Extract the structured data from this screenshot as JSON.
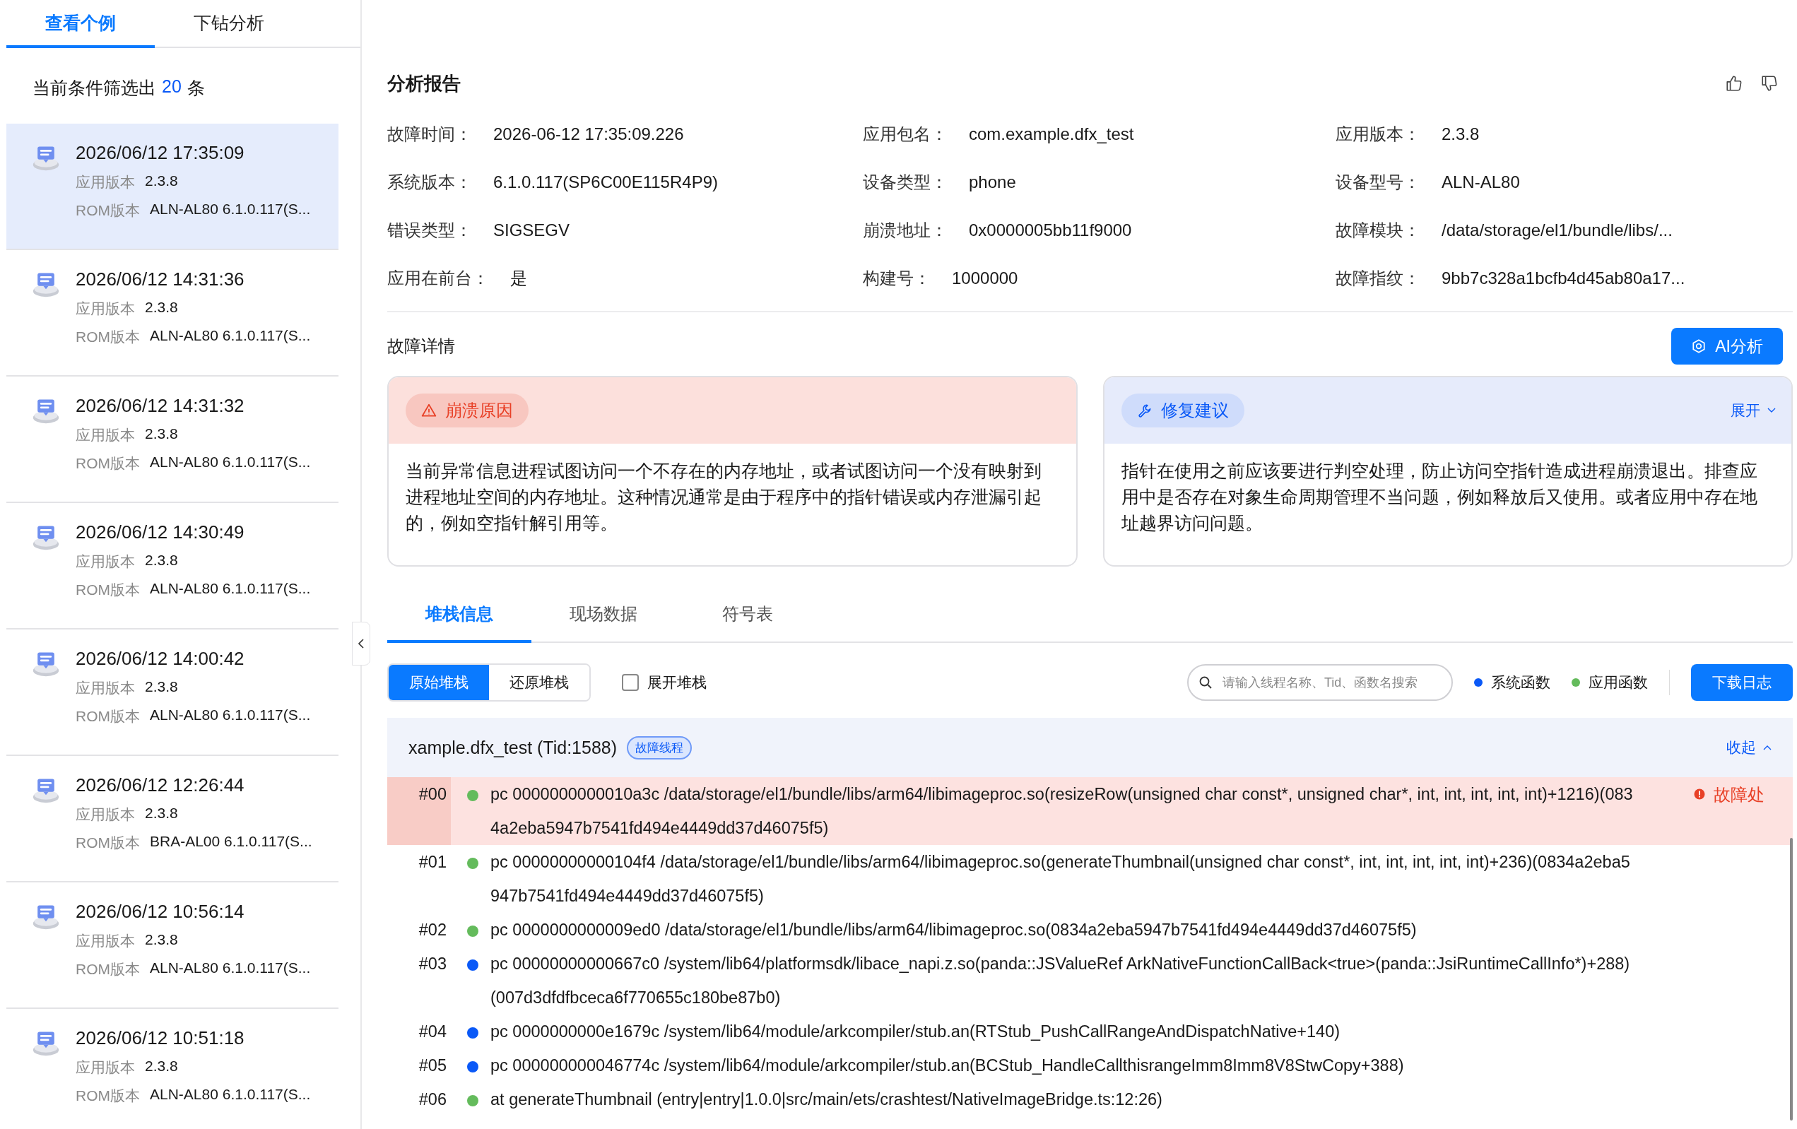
{
  "tabs": [
    {
      "label": "查看个例",
      "selected": true
    },
    {
      "label": "下钻分析",
      "selected": false
    }
  ],
  "filter": {
    "prefix": "当前条件筛选出",
    "count": "20",
    "suffix": "条"
  },
  "cases": [
    {
      "time": "2026/06/12 17:35:09",
      "app_label": "应用版本",
      "app_version": "2.3.8",
      "rom_label": "ROM版本",
      "rom": "ALN-AL80 6.1.0.117(S...",
      "selected": true
    },
    {
      "time": "2026/06/12 14:31:36",
      "app_label": "应用版本",
      "app_version": "2.3.8",
      "rom_label": "ROM版本",
      "rom": "ALN-AL80 6.1.0.117(S...",
      "selected": false
    },
    {
      "time": "2026/06/12 14:31:32",
      "app_label": "应用版本",
      "app_version": "2.3.8",
      "rom_label": "ROM版本",
      "rom": "ALN-AL80 6.1.0.117(S...",
      "selected": false
    },
    {
      "time": "2026/06/12 14:30:49",
      "app_label": "应用版本",
      "app_version": "2.3.8",
      "rom_label": "ROM版本",
      "rom": "ALN-AL80 6.1.0.117(S...",
      "selected": false
    },
    {
      "time": "2026/06/12 14:00:42",
      "app_label": "应用版本",
      "app_version": "2.3.8",
      "rom_label": "ROM版本",
      "rom": "ALN-AL80 6.1.0.117(S...",
      "selected": false
    },
    {
      "time": "2026/06/12 12:26:44",
      "app_label": "应用版本",
      "app_version": "2.3.8",
      "rom_label": "ROM版本",
      "rom": "BRA-AL00 6.1.0.117(S...",
      "selected": false
    },
    {
      "time": "2026/06/12 10:56:14",
      "app_label": "应用版本",
      "app_version": "2.3.8",
      "rom_label": "ROM版本",
      "rom": "ALN-AL80 6.1.0.117(S...",
      "selected": false
    },
    {
      "time": "2026/06/12 10:51:18",
      "app_label": "应用版本",
      "app_version": "2.3.8",
      "rom_label": "ROM版本",
      "rom": "ALN-AL80 6.1.0.117(S...",
      "selected": false
    }
  ],
  "report": {
    "title": "分析报告",
    "fields": [
      {
        "label": "故障时间：",
        "value": "2026-06-12 17:35:09.226"
      },
      {
        "label": "应用包名：",
        "value": "com.example.dfx_test"
      },
      {
        "label": "应用版本：",
        "value": "2.3.8"
      },
      {
        "label": "系统版本：",
        "value": "6.1.0.117(SP6C00E115R4P9)"
      },
      {
        "label": "设备类型：",
        "value": "phone"
      },
      {
        "label": "设备型号：",
        "value": "ALN-AL80"
      },
      {
        "label": "错误类型：",
        "value": "SIGSEGV"
      },
      {
        "label": "崩溃地址：",
        "value": "0x0000005bb11f9000"
      },
      {
        "label": "故障模块：",
        "value": "/data/storage/el1/bundle/libs/..."
      },
      {
        "label": "应用在前台：",
        "value": "是"
      },
      {
        "label": "构建号：",
        "value": "1000000"
      },
      {
        "label": "故障指纹：",
        "value": "9bb7c328a1bcfb4d45ab80a17..."
      }
    ]
  },
  "details": {
    "title": "故障详情",
    "ai_button": "AI分析",
    "cards": [
      {
        "kind": "cause",
        "tag": "崩溃原因",
        "text": "当前异常信息进程试图访问一个不存在的内存地址，或者试图访问一个没有映射到进程地址空间的内存地址。这种情况通常是由于程序中的指针错误或内存泄漏引起的，例如空指针解引用等。"
      },
      {
        "kind": "suggestion",
        "tag": "修复建议",
        "toggle": "展开",
        "text": "指针在使用之前应该要进行判空处理，防止访问空指针造成进程崩溃退出。排查应用中是否存在对象生命周期管理不当问题，例如释放后又使用。或者应用中存在地址越界访问问题。"
      }
    ]
  },
  "stack_tabs": [
    {
      "label": "堆栈信息",
      "selected": true
    },
    {
      "label": "现场数据",
      "selected": false
    },
    {
      "label": "符号表",
      "selected": false
    }
  ],
  "stack_modes": [
    {
      "label": "原始堆栈",
      "selected": true
    },
    {
      "label": "还原堆栈",
      "selected": false
    }
  ],
  "expand_stack": {
    "label": "展开堆栈",
    "checked": false
  },
  "search": {
    "placeholder": "请输入线程名称、Tid、函数名搜索"
  },
  "legend": [
    {
      "label": "系统函数",
      "color": "#0a59f7"
    },
    {
      "label": "应用函数",
      "color": "#64bb5c"
    }
  ],
  "download_button": "下载日志",
  "thread": {
    "name": "xample.dfx_test (Tid:1588)",
    "badge": "故障线程",
    "toggle": "收起",
    "expanded": true
  },
  "frames": [
    {
      "index": "#00",
      "color": "#64bb5c",
      "fault": true,
      "fault_label": "故障处",
      "text": "pc 0000000000010a3c /data/storage/el1/bundle/libs/arm64/libimageproc.so(resizeRow(unsigned char const*, unsigned char*, int, int, int, int, int)+1216)(0834a2eba5947b7541fd494e4449dd37d46075f5)"
    },
    {
      "index": "#01",
      "color": "#64bb5c",
      "fault": false,
      "text": "pc 00000000000104f4 /data/storage/el1/bundle/libs/arm64/libimageproc.so(generateThumbnail(unsigned char const*, int, int, int, int, int)+236)(0834a2eba5947b7541fd494e4449dd37d46075f5)"
    },
    {
      "index": "#02",
      "color": "#64bb5c",
      "fault": false,
      "text": "pc 0000000000009ed0 /data/storage/el1/bundle/libs/arm64/libimageproc.so(0834a2eba5947b7541fd494e4449dd37d46075f5)"
    },
    {
      "index": "#03",
      "color": "#0a59f7",
      "fault": false,
      "text": "pc 00000000000667c0 /system/lib64/platformsdk/libace_napi.z.so(panda::JSValueRef ArkNativeFunctionCallBack<true>(panda::JsiRuntimeCallInfo*)+288)(007d3dfdfbceca6f770655c180be87b0)"
    },
    {
      "index": "#04",
      "color": "#0a59f7",
      "fault": false,
      "text": "pc 0000000000e1679c /system/lib64/module/arkcompiler/stub.an(RTStub_PushCallRangeAndDispatchNative+140)"
    },
    {
      "index": "#05",
      "color": "#0a59f7",
      "fault": false,
      "text": "pc 000000000046774c /system/lib64/module/arkcompiler/stub.an(BCStub_HandleCallthisrangeImm8Imm8V8StwCopy+388)"
    },
    {
      "index": "#06",
      "color": "#64bb5c",
      "fault": false,
      "text": "at generateThumbnail (entry|entry|1.0.0|src/main/ets/crashtest/NativeImageBridge.ts:12:26)"
    }
  ]
}
